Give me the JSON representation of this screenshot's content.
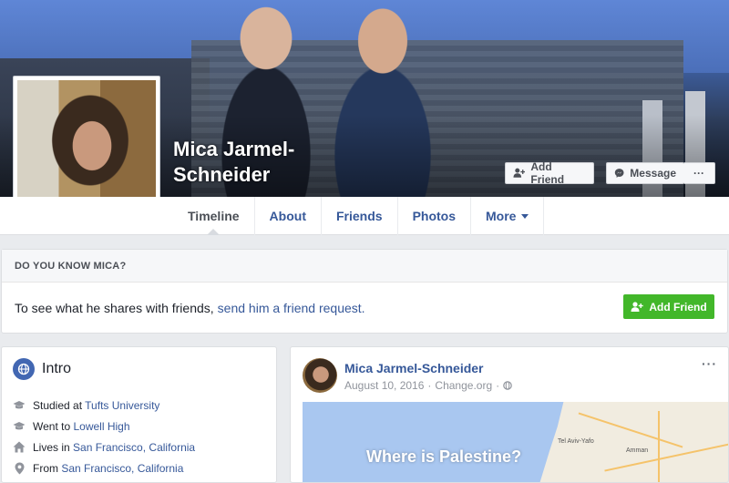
{
  "profile": {
    "name": "Mica Jarmel-Schneider"
  },
  "cover_buttons": {
    "add_friend": "Add Friend",
    "message": "Message",
    "more": "···"
  },
  "tabs": [
    {
      "label": "Timeline",
      "active": true
    },
    {
      "label": "About"
    },
    {
      "label": "Friends"
    },
    {
      "label": "Photos"
    },
    {
      "label": "More"
    }
  ],
  "know_card": {
    "heading": "DO YOU KNOW MICA?",
    "text": "To see what he shares with friends,",
    "link": "send him a friend request.",
    "button": "Add Friend"
  },
  "intro": {
    "title": "Intro",
    "items": [
      {
        "icon": "graduation-cap-icon",
        "prefix": "Studied at",
        "link": "Tufts University"
      },
      {
        "icon": "graduation-cap-icon",
        "prefix": "Went to",
        "link": "Lowell High"
      },
      {
        "icon": "home-icon",
        "prefix": "Lives in",
        "link": "San Francisco, California"
      },
      {
        "icon": "location-pin-icon",
        "prefix": "From",
        "link": "San Francisco, California"
      }
    ]
  },
  "post": {
    "author": "Mica Jarmel-Schneider",
    "date": "August 10, 2016",
    "source": "Change.org",
    "map_title": "Where is Palestine?",
    "map_labels": [
      "Tel Aviv-Yafo",
      "Amman"
    ]
  },
  "colors": {
    "link_blue": "#365899",
    "fb_blue": "#4267b2",
    "green": "#42b72a",
    "background": "#e9ebee"
  }
}
